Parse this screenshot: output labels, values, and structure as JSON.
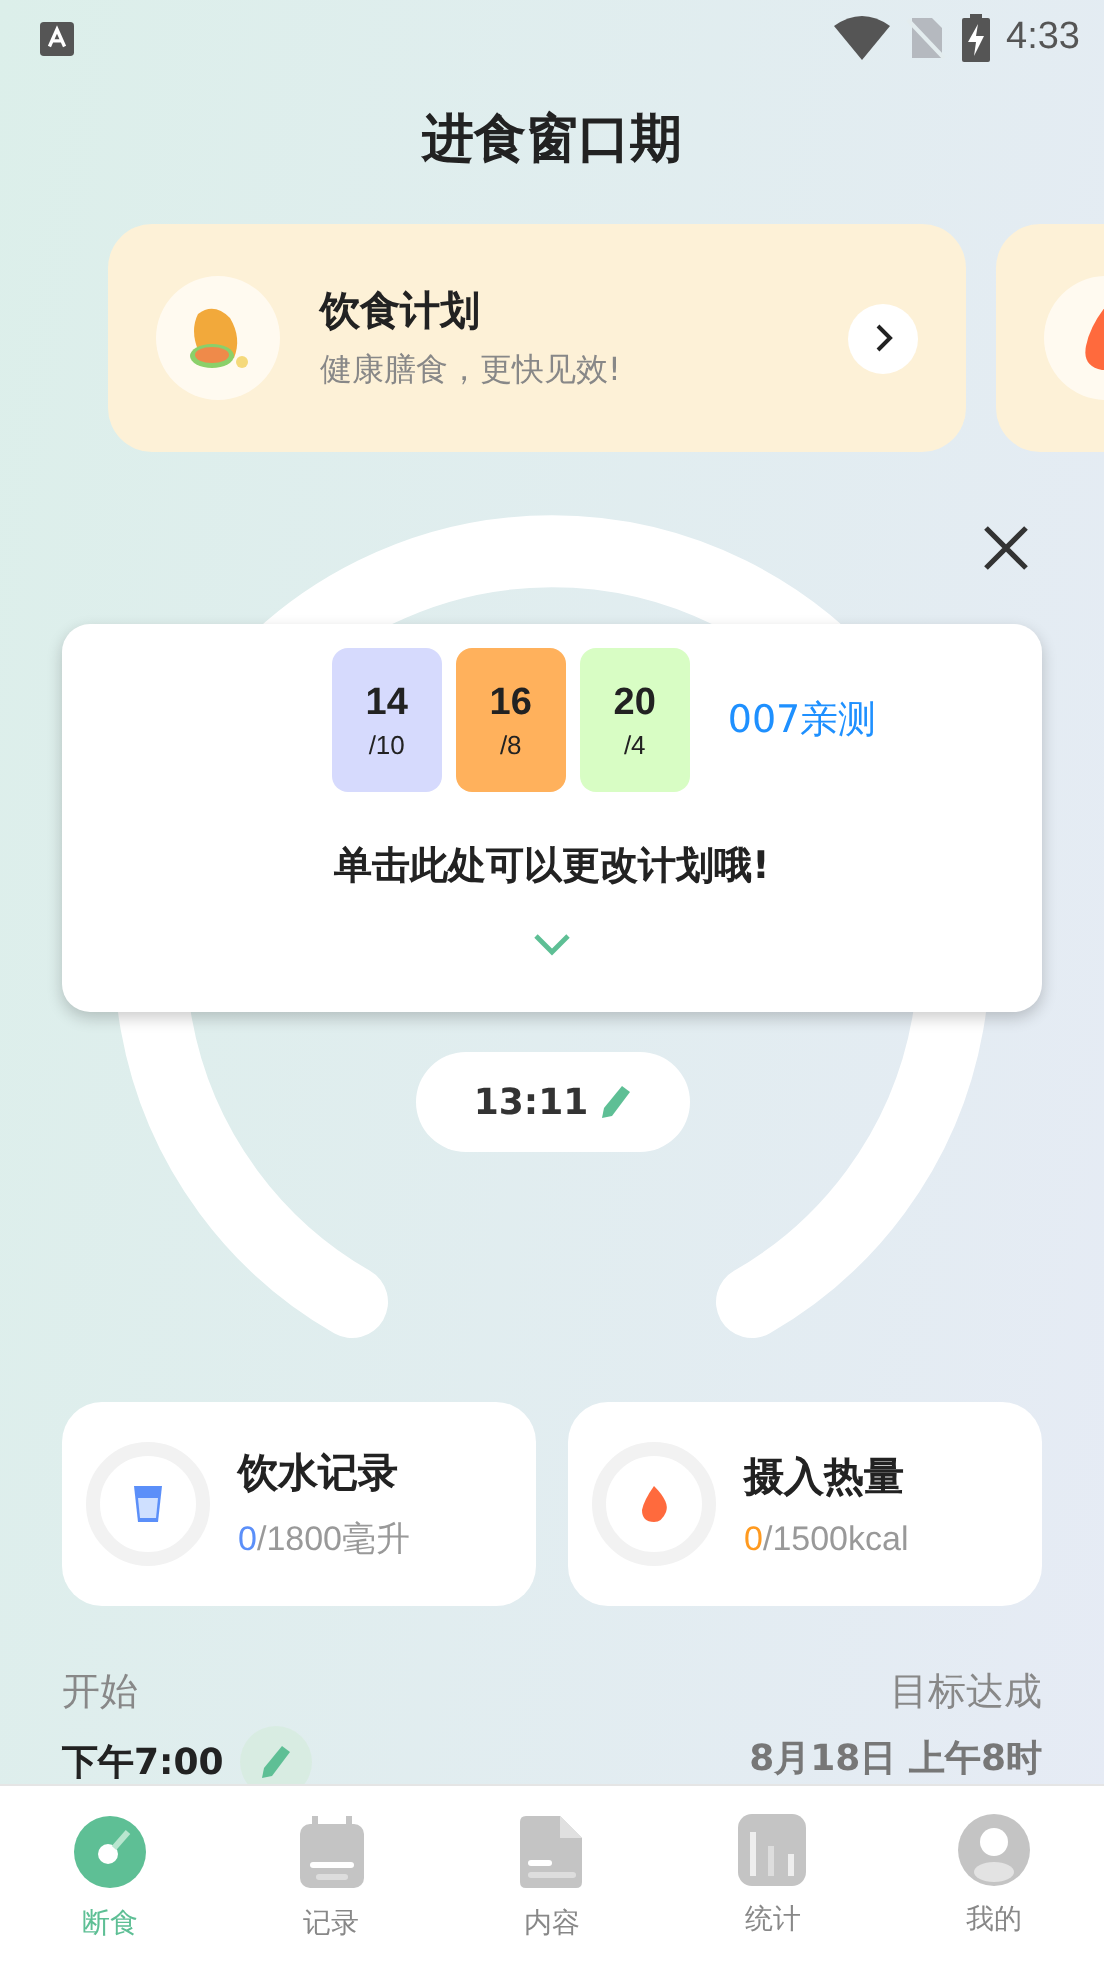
{
  "status_bar": {
    "time": "4:33"
  },
  "title": "进食窗口期",
  "promo_cards": [
    {
      "kind": "meal",
      "title": "饮食计划",
      "subtitle": "健康膳食，更快见效!"
    },
    {
      "kind": "fire"
    }
  ],
  "plan_popup": {
    "options": [
      {
        "hours": "14",
        "ratio": "/10",
        "color": "#d6dafd"
      },
      {
        "hours": "16",
        "ratio": "/8",
        "color": "#ffb15c"
      },
      {
        "hours": "20",
        "ratio": "/4",
        "color": "#d8fdc4"
      }
    ],
    "link": "007亲测",
    "hint": "单击此处可以更改计划哦!"
  },
  "timer": {
    "time": "13:11"
  },
  "stats": [
    {
      "kind": "water",
      "title": "饮水记录",
      "value": "0",
      "total": "/1800毫升",
      "color": "#5b8ff9"
    },
    {
      "kind": "calories",
      "title": "摄入热量",
      "value": "0",
      "total": "/1500kcal",
      "color": "#ff9a1f"
    }
  ],
  "schedule": {
    "start_label": "开始",
    "start_time": "下午7:00",
    "goal_label": "目标达成",
    "goal_time": "8月18日 上午8时"
  },
  "tabs": [
    {
      "kind": "fasting",
      "label": "断食",
      "selected": true
    },
    {
      "kind": "record",
      "label": "记录",
      "selected": false
    },
    {
      "kind": "content",
      "label": "内容",
      "selected": false
    },
    {
      "kind": "stats",
      "label": "统计",
      "selected": false
    },
    {
      "kind": "profile",
      "label": "我的",
      "selected": false
    }
  ]
}
